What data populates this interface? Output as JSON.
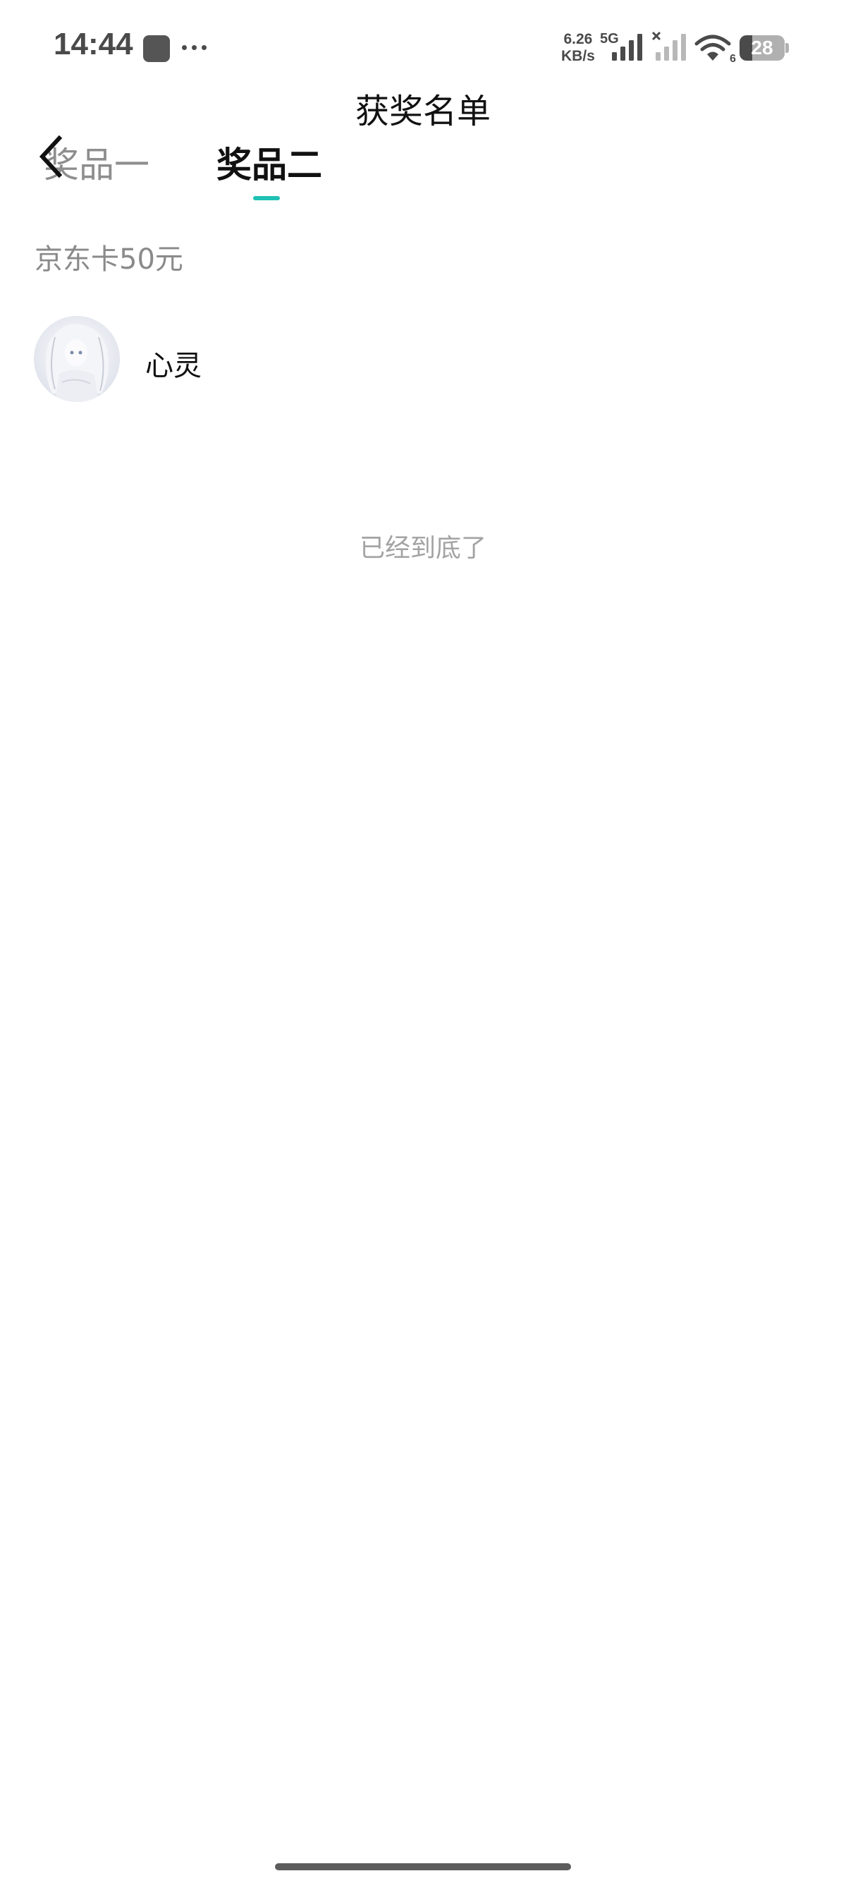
{
  "status_bar": {
    "time": "14:44",
    "speed_value": "6.26",
    "speed_unit": "KB/s",
    "network_type": "5G",
    "wifi_badge": "6",
    "battery_level": 28,
    "battery_text": "28"
  },
  "header": {
    "title": "获奖名单"
  },
  "tabs": [
    {
      "label": "奖品一",
      "active": false
    },
    {
      "label": "奖品二",
      "active": true
    }
  ],
  "prize": {
    "name": "京东卡50元"
  },
  "winners": [
    {
      "name": "心灵"
    }
  ],
  "list_end_text": "已经到底了",
  "colors": {
    "accent": "#1fc1b3",
    "muted_text": "#8a8a8a",
    "primary_text": "#111111"
  }
}
